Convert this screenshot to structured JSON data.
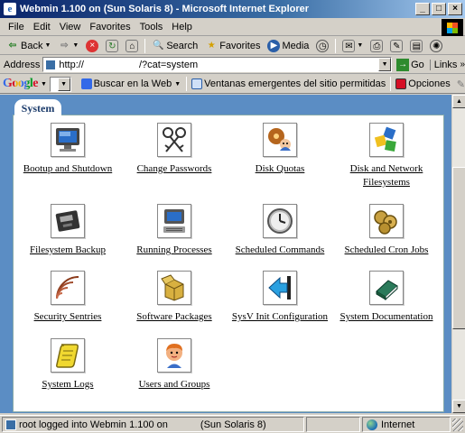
{
  "window": {
    "title": "Webmin 1.100 on          (Sun Solaris 8) - Microsoft Internet Explorer",
    "btn_min": "_",
    "btn_max": "□",
    "btn_close": "×"
  },
  "menu": [
    "File",
    "Edit",
    "View",
    "Favorites",
    "Tools",
    "Help"
  ],
  "toolbar": {
    "back": "Back",
    "search": "Search",
    "favorites": "Favorites",
    "media": "Media"
  },
  "address": {
    "label": "Address",
    "url": "http://                    /?cat=system",
    "go": "Go",
    "links": "Links"
  },
  "google": {
    "logo": "Google",
    "search_web": "Buscar en la Web",
    "popups": "Ventanas emergentes del sitio permitidas",
    "options": "Opciones"
  },
  "tab": {
    "label": "System"
  },
  "modules": [
    {
      "label": "Bootup and Shutdown",
      "icon": "monitor-icon"
    },
    {
      "label": "Change Passwords",
      "icon": "keys-icon"
    },
    {
      "label": "Disk Quotas",
      "icon": "disk-quota-icon"
    },
    {
      "label": "Disk and Network Filesystems",
      "icon": "network-filesystem-icon"
    },
    {
      "label": "Filesystem Backup",
      "icon": "tape-drive-icon"
    },
    {
      "label": "Running Processes",
      "icon": "computer-processes-icon"
    },
    {
      "label": "Scheduled Commands",
      "icon": "clock-icon"
    },
    {
      "label": "Scheduled Cron Jobs",
      "icon": "cron-gears-icon"
    },
    {
      "label": "Security Sentries",
      "icon": "signal-waves-icon"
    },
    {
      "label": "Software Packages",
      "icon": "package-box-icon"
    },
    {
      "label": "SysV Init Configuration",
      "icon": "arrow-left-icon"
    },
    {
      "label": "System Documentation",
      "icon": "book-icon"
    },
    {
      "label": "System Logs",
      "icon": "scroll-icon"
    },
    {
      "label": "Users and Groups",
      "icon": "user-face-icon"
    }
  ],
  "status": {
    "text": "root logged into Webmin 1.100 on",
    "text2": "(Sun Solaris 8)",
    "zone": "Internet"
  }
}
